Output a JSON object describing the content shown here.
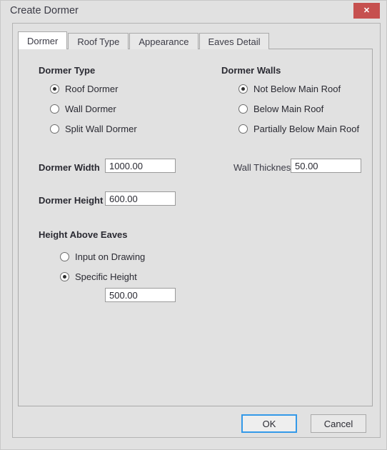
{
  "window": {
    "title": "Create Dormer",
    "close_label": "✕"
  },
  "tabs": [
    {
      "label": "Dormer",
      "active": true
    },
    {
      "label": "Roof Type",
      "active": false
    },
    {
      "label": "Appearance",
      "active": false
    },
    {
      "label": "Eaves Detail",
      "active": false
    }
  ],
  "dormer_type": {
    "title": "Dormer Type",
    "options": [
      {
        "label": "Roof Dormer",
        "selected": true
      },
      {
        "label": "Wall Dormer",
        "selected": false
      },
      {
        "label": "Split Wall Dormer",
        "selected": false
      }
    ]
  },
  "dormer_walls": {
    "title": "Dormer Walls",
    "options": [
      {
        "label": "Not Below Main Roof",
        "selected": true
      },
      {
        "label": "Below Main Roof",
        "selected": false
      },
      {
        "label": "Partially Below Main Roof",
        "selected": false
      }
    ]
  },
  "dimensions": {
    "dormer_width_label": "Dormer Width",
    "dormer_width_value": "1000.00",
    "dormer_height_label": "Dormer Height",
    "dormer_height_value": "600.00",
    "wall_thickness_label": "Wall Thickness",
    "wall_thickness_value": "50.00"
  },
  "height_above_eaves": {
    "title": "Height Above Eaves",
    "options": [
      {
        "label": "Input on Drawing",
        "selected": false
      },
      {
        "label": "Specific Height",
        "selected": true
      }
    ],
    "specific_height_value": "500.00"
  },
  "footer": {
    "ok_label": "OK",
    "cancel_label": "Cancel"
  },
  "colors": {
    "window_background": "#e1e1e1",
    "close_button": "#c6504f",
    "active_tab": "#ffffff",
    "default_button_border": "#3399e8",
    "panel_border": "#a9a9a9",
    "field_background": "#ffffff"
  }
}
